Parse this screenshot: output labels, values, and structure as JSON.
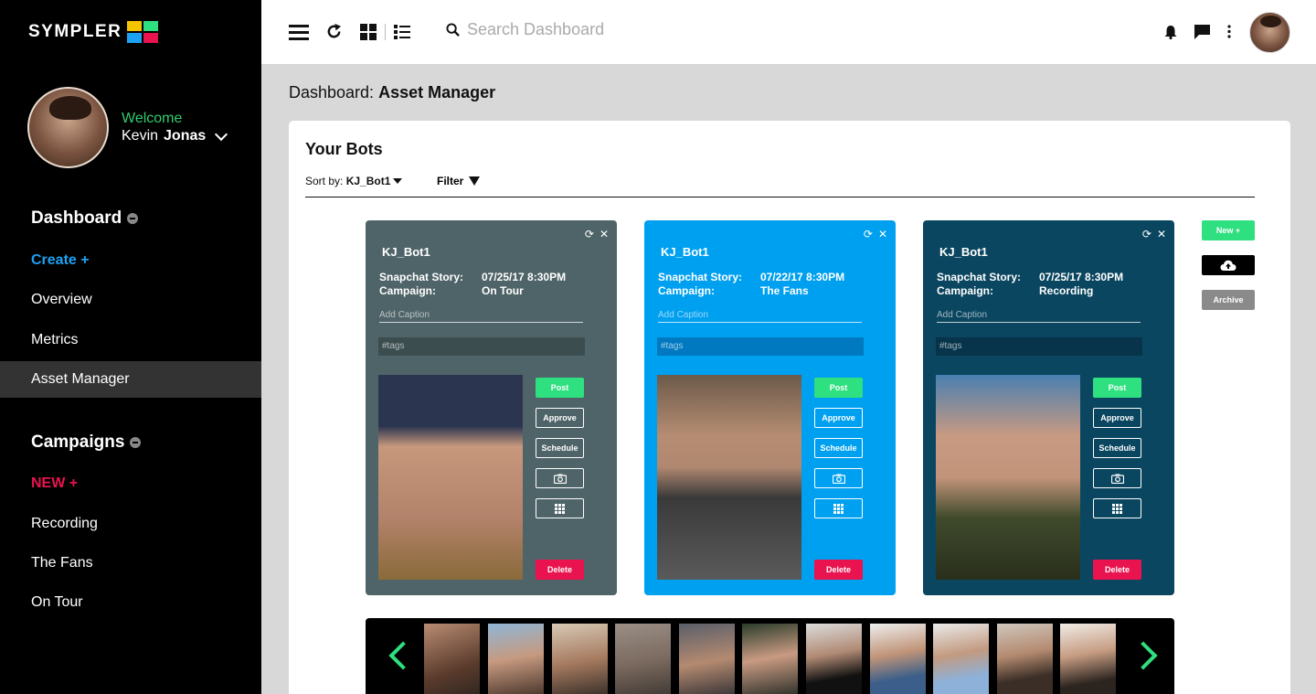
{
  "app": {
    "logo_text": "SYMPLER",
    "logo_colors": [
      "#f5c400",
      "#1da1f2",
      "#2ee07f",
      "#e8134f"
    ]
  },
  "sidebar": {
    "welcome": "Welcome",
    "user_first": "Kevin",
    "user_last": "Jonas",
    "dashboard_heading": "Dashboard",
    "dashboard_items": [
      {
        "label": "Create +"
      },
      {
        "label": "Overview"
      },
      {
        "label": "Metrics"
      },
      {
        "label": "Asset Manager"
      }
    ],
    "campaigns_heading": "Campaigns",
    "campaign_items": [
      {
        "label": "NEW +"
      },
      {
        "label": "Recording"
      },
      {
        "label": "The Fans"
      },
      {
        "label": "On Tour"
      }
    ]
  },
  "topbar": {
    "search_placeholder": "Search Dashboard"
  },
  "breadcrumb": {
    "prefix": "Dashboard:",
    "current": "Asset Manager"
  },
  "panel": {
    "title": "Your Bots",
    "sort_label": "Sort by:",
    "sort_value": "KJ_Bot1",
    "filter_label": "Filter"
  },
  "cards": [
    {
      "name": "KJ_Bot1",
      "story_label": "Snapchat Story:",
      "story_value": "07/25/17 8:30PM",
      "campaign_label": "Campaign:",
      "campaign_value": "On Tour",
      "caption_placeholder": "Add Caption",
      "tags_placeholder": "#tags",
      "bg": "#4f6468",
      "tags_bg": "#3c4d50",
      "post": "Post",
      "approve": "Approve",
      "schedule": "Schedule",
      "delete": "Delete"
    },
    {
      "name": "KJ_Bot1",
      "story_label": "Snapchat Story:",
      "story_value": "07/22/17 8:30PM",
      "campaign_label": "Campaign:",
      "campaign_value": "The Fans",
      "caption_placeholder": "Add Caption",
      "tags_placeholder": "#tags",
      "bg": "#00a0f0",
      "tags_bg": "#0079c0",
      "post": "Post",
      "approve": "Approve",
      "schedule": "Schedule",
      "delete": "Delete"
    },
    {
      "name": "KJ_Bot1",
      "story_label": "Snapchat Story:",
      "story_value": "07/25/17 8:30PM",
      "campaign_label": "Campaign:",
      "campaign_value": "Recording",
      "caption_placeholder": "Add Caption",
      "tags_placeholder": "#tags",
      "bg": "#0a4660",
      "tags_bg": "#07344a",
      "post": "Post",
      "approve": "Approve",
      "schedule": "Schedule",
      "delete": "Delete"
    }
  ],
  "actions": {
    "new_label": "New +",
    "archive_label": "Archive"
  }
}
